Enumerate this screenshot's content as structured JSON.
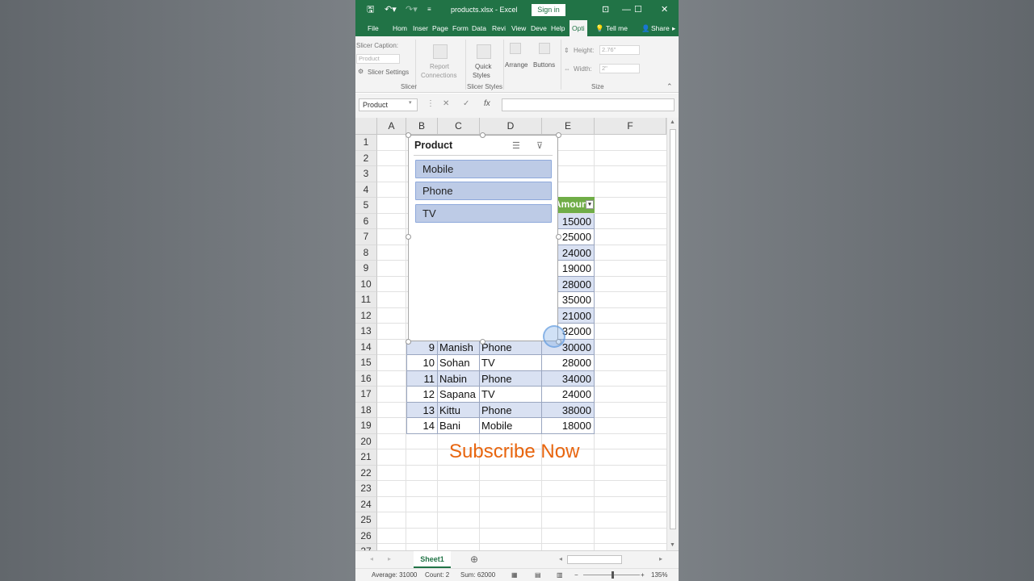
{
  "window": {
    "filename": "products.xlsx",
    "app": "Excel",
    "title": "products.xlsx  -  Excel",
    "sign_in": "Sign in"
  },
  "tabs": [
    "File",
    "Hom",
    "Inser",
    "Page",
    "Form",
    "Data",
    "Revi",
    "View",
    "Deve",
    "Help",
    "Opti"
  ],
  "tell_me": "Tell me",
  "share": "Share",
  "ribbon": {
    "slicer_caption_label": "Slicer Caption:",
    "slicer_caption_value": "Product",
    "slicer_settings": "Slicer Settings",
    "report_connections": [
      "Report",
      "Connections"
    ],
    "quick_styles": [
      "Quick",
      "Styles"
    ],
    "arrange": "Arrange",
    "buttons": "Buttons",
    "height_label": "Height:",
    "height_value": "2.76\"",
    "width_label": "Width:",
    "width_value": "2\"",
    "groups": {
      "slicer": "Slicer",
      "slicer_styles": "Slicer Styles",
      "size": "Size"
    }
  },
  "formula_bar": {
    "name_box": "Product",
    "cancel": "✕",
    "enter": "✓",
    "fx": "fx"
  },
  "columns": [
    "A",
    "B",
    "C",
    "D",
    "E",
    "F"
  ],
  "rows": [
    "1",
    "2",
    "3",
    "4",
    "5",
    "6",
    "7",
    "8",
    "9",
    "10",
    "11",
    "12",
    "13",
    "14",
    "15",
    "16",
    "17",
    "18",
    "19",
    "20",
    "21",
    "22",
    "23",
    "24",
    "25",
    "26",
    "27"
  ],
  "table": {
    "header_amount": "Amount",
    "amounts_hidden_rows": [
      "15000",
      "25000",
      "24000",
      "19000",
      "28000",
      "35000",
      "21000",
      "32000"
    ],
    "visible_rows": [
      {
        "id": "9",
        "name": "Manish",
        "product": "Phone",
        "amount": "30000"
      },
      {
        "id": "10",
        "name": "Sohan",
        "product": "TV",
        "amount": "28000"
      },
      {
        "id": "11",
        "name": "Nabin",
        "product": "Phone",
        "amount": "34000"
      },
      {
        "id": "12",
        "name": "Sapana",
        "product": "TV",
        "amount": "24000"
      },
      {
        "id": "13",
        "name": "Kittu",
        "product": "Phone",
        "amount": "38000"
      },
      {
        "id": "14",
        "name": "Bani",
        "product": "Mobile",
        "amount": "18000"
      }
    ]
  },
  "slicer": {
    "title": "Product",
    "items": [
      "Mobile",
      "Phone",
      "TV"
    ]
  },
  "overlay_text": "Subscribe Now",
  "sheet_tab": "Sheet1",
  "status": {
    "average": "Average: 31000",
    "count": "Count: 2",
    "sum": "Sum: 62000",
    "zoom": "135%"
  },
  "colors": {
    "excel_green": "#217346",
    "header_green": "#70ad47",
    "band_blue": "#d9e1f2",
    "slicer_item": "#bdcbe6",
    "subscribe": "#e8650e"
  }
}
